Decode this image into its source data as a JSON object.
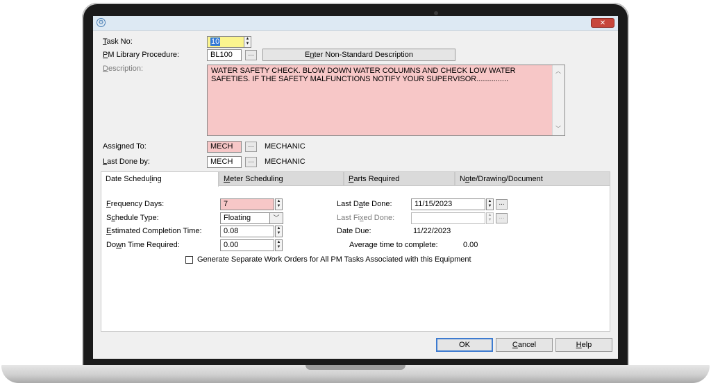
{
  "labels": {
    "task_no": "Task No:",
    "pm_library": "PM Library Procedure:",
    "description": "Description:",
    "assigned_to": "Assigned To:",
    "last_done_by": "Last Done by:",
    "frequency_days": "Frequency Days:",
    "schedule_type": "Schedule Type:",
    "estimated_completion": "Estimated Completion Time:",
    "down_time": "Down Time Required:",
    "last_date_done": "Last Date Done:",
    "last_fixed_done": "Last Fixed Done:",
    "date_due": "Date Due:",
    "avg_time": "Average time to complete:"
  },
  "values": {
    "task_no": "10",
    "pm_library": "BL100",
    "description": "WATER SAFETY CHECK. BLOW DOWN WATER COLUMNS AND CHECK LOW WATER SAFETIES. IF THE SAFETY MALFUNCTIONS NOTIFY YOUR SUPERVISOR...............",
    "assigned_to_code": "MECH",
    "assigned_to_name": "MECHANIC",
    "last_done_by_code": "MECH",
    "last_done_by_name": "MECHANIC",
    "frequency_days": "7",
    "schedule_type": "Floating",
    "estimated_completion": "0.08",
    "down_time": "0.00",
    "last_date_done": "11/15/2023",
    "last_fixed_done": "",
    "date_due": "11/22/2023",
    "avg_time": "0.00"
  },
  "buttons": {
    "ellipsis": "...",
    "non_standard": "Enter Non-Standard Description",
    "ok": "OK",
    "cancel": "Cancel",
    "help": "Help",
    "close": "✕"
  },
  "tabs": [
    "Date Scheduling",
    "Meter Scheduling",
    "Parts Required",
    "Note/Drawing/Document"
  ],
  "checkbox_label": "Generate Separate Work Orders for All PM Tasks Associated with this Equipment",
  "icons": {
    "app": "gear-icon",
    "spin": "spinner-arrows-icon",
    "dropdown": "chevron-down-icon",
    "scroll_up": "chevron-up-icon",
    "scroll_down": "chevron-down-icon"
  },
  "colors": {
    "required_field": "#f7c7c7",
    "focused_field": "#fbf48e",
    "default_button_border": "#3d7bd0",
    "close_button": "#c7463b"
  }
}
